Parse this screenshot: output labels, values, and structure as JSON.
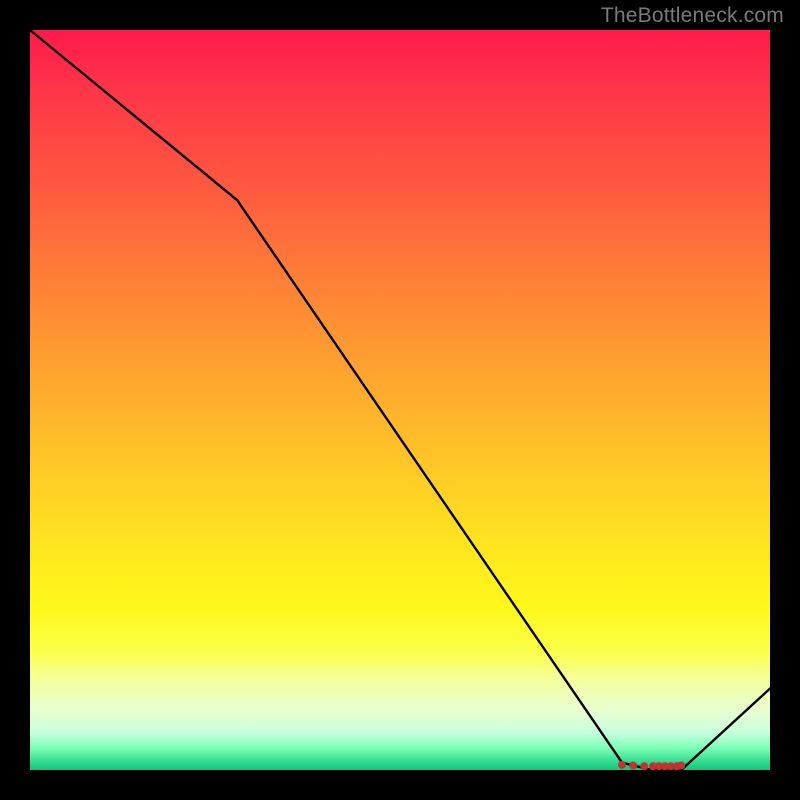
{
  "watermark": "TheBottleneck.com",
  "chart_data": {
    "type": "line",
    "title": "",
    "xlabel": "",
    "ylabel": "",
    "xlim": [
      0,
      100
    ],
    "ylim": [
      0,
      100
    ],
    "grid": false,
    "legend": false,
    "series": [
      {
        "name": "bottleneck-curve",
        "type": "line",
        "x": [
          0,
          28,
          80,
          84,
          88,
          100
        ],
        "y": [
          100,
          77,
          1,
          0,
          0,
          11
        ]
      },
      {
        "name": "optimal-range-markers",
        "type": "scatter",
        "x": [
          80,
          81.5,
          83,
          84.2,
          85,
          85.8,
          86.6,
          87.4,
          88
        ],
        "y": [
          0.7,
          0.6,
          0.5,
          0.5,
          0.5,
          0.5,
          0.5,
          0.5,
          0.6
        ]
      }
    ],
    "background_gradient": {
      "top": "#ff1a4a",
      "middle": "#ffe61f",
      "bottom": "#17c27a"
    }
  }
}
